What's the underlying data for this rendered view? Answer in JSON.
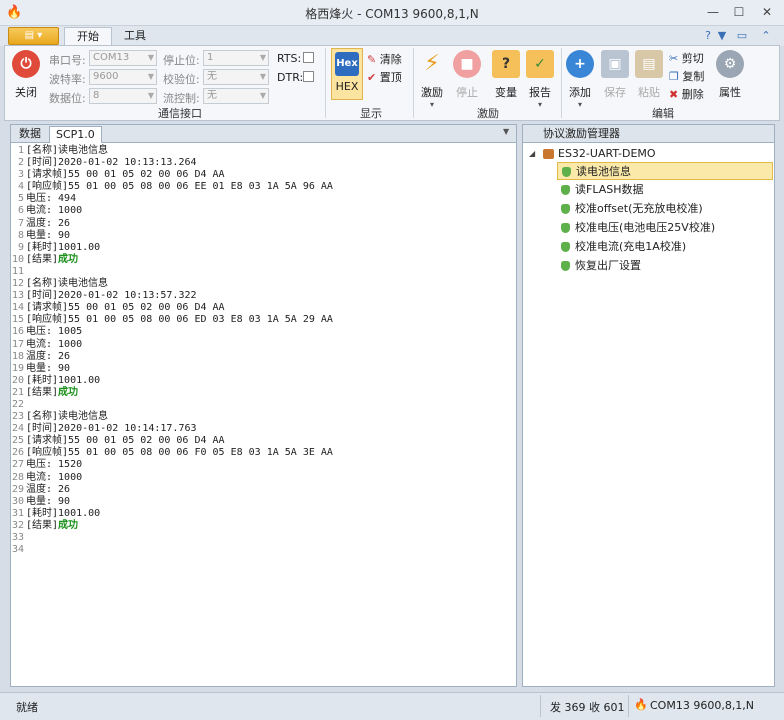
{
  "window": {
    "title": "格西烽火 - COM13  9600,8,1,N",
    "min": "—",
    "max": "☐",
    "close": "✕"
  },
  "ribbon_tabs": {
    "start": "开始",
    "tools": "工具"
  },
  "serial": {
    "close_label": "关闭",
    "port_label": "串口号:",
    "port_value": "COM13",
    "baud_label": "波特率:",
    "baud_value": "9600",
    "databits_label": "数据位:",
    "databits_value": "8",
    "stopbits_label": "停止位:",
    "stopbits_value": "1",
    "parity_label": "校验位:",
    "parity_value": "无",
    "flow_label": "流控制:",
    "flow_value": "无",
    "rts_label": "RTS:",
    "dtr_label": "DTR:",
    "group_label": "通信接口"
  },
  "display": {
    "hex_icon": "Hex",
    "hex_label": "HEX",
    "clear_label": "清除",
    "top_label": "置顶",
    "group_label": "显示"
  },
  "stimulus": {
    "run_label": "激励",
    "stop_label": "停止",
    "var_label": "变量",
    "report_label": "报告",
    "group_label": "激励"
  },
  "edit": {
    "add_label": "添加",
    "save_label": "保存",
    "paste_label": "粘贴",
    "cut_label": "剪切",
    "copy_label": "复制",
    "delete_label": "删除",
    "props_label": "属性",
    "group_label": "编辑"
  },
  "doc_tabs": {
    "data": "数据",
    "scp": "SCP1.0"
  },
  "editor_lines": [
    [
      "1",
      "[名称]读电池信息",
      ""
    ],
    [
      "2",
      "[时间]2020-01-02 10:13:13.264",
      ""
    ],
    [
      "3",
      "[请求帧]55 00 01 05 02 00 06 D4 AA",
      ""
    ],
    [
      "4",
      "[响应帧]55 01 00 05 08 00 06 EE 01 E8 03 1A 5A 96 AA",
      ""
    ],
    [
      "5",
      "电压: 494",
      ""
    ],
    [
      "6",
      "电流: 1000",
      ""
    ],
    [
      "7",
      "温度: 26",
      ""
    ],
    [
      "8",
      "电量: 90",
      ""
    ],
    [
      "9",
      "[耗时]1001.00",
      ""
    ],
    [
      "10",
      "[结果]",
      "成功"
    ],
    [
      "11",
      "",
      ""
    ],
    [
      "12",
      "[名称]读电池信息",
      ""
    ],
    [
      "13",
      "[时间]2020-01-02 10:13:57.322",
      ""
    ],
    [
      "14",
      "[请求帧]55 00 01 05 02 00 06 D4 AA",
      ""
    ],
    [
      "15",
      "[响应帧]55 01 00 05 08 00 06 ED 03 E8 03 1A 5A 29 AA",
      ""
    ],
    [
      "16",
      "电压: 1005",
      ""
    ],
    [
      "17",
      "电流: 1000",
      ""
    ],
    [
      "18",
      "温度: 26",
      ""
    ],
    [
      "19",
      "电量: 90",
      ""
    ],
    [
      "20",
      "[耗时]1001.00",
      ""
    ],
    [
      "21",
      "[结果]",
      "成功"
    ],
    [
      "22",
      "",
      ""
    ],
    [
      "23",
      "[名称]读电池信息",
      ""
    ],
    [
      "24",
      "[时间]2020-01-02 10:14:17.763",
      ""
    ],
    [
      "25",
      "[请求帧]55 00 01 05 02 00 06 D4 AA",
      ""
    ],
    [
      "26",
      "[响应帧]55 01 00 05 08 00 06 F0 05 E8 03 1A 5A 3E AA",
      ""
    ],
    [
      "27",
      "电压: 1520",
      ""
    ],
    [
      "28",
      "电流: 1000",
      ""
    ],
    [
      "29",
      "温度: 26",
      ""
    ],
    [
      "30",
      "电量: 90",
      ""
    ],
    [
      "31",
      "[耗时]1001.00",
      ""
    ],
    [
      "32",
      "[结果]",
      "成功"
    ],
    [
      "33",
      "",
      ""
    ],
    [
      "34",
      "",
      ""
    ]
  ],
  "protocol_panel": {
    "title": "协议激励管理器",
    "root": "ES32-UART-DEMO",
    "items": [
      "读电池信息",
      "读FLASH数据",
      "校准offset(无充放电校准)",
      "校准电压(电池电压25V校准)",
      "校准电流(充电1A校准)",
      "恢复出厂设置"
    ]
  },
  "status": {
    "left": "就绪",
    "counts": "发 369  收 601",
    "port": "COM13  9600,8,1,N"
  },
  "colors": {
    "accent": "#3b6fb6",
    "success": "#1a8f1a",
    "selected": "#fbe9a9"
  }
}
